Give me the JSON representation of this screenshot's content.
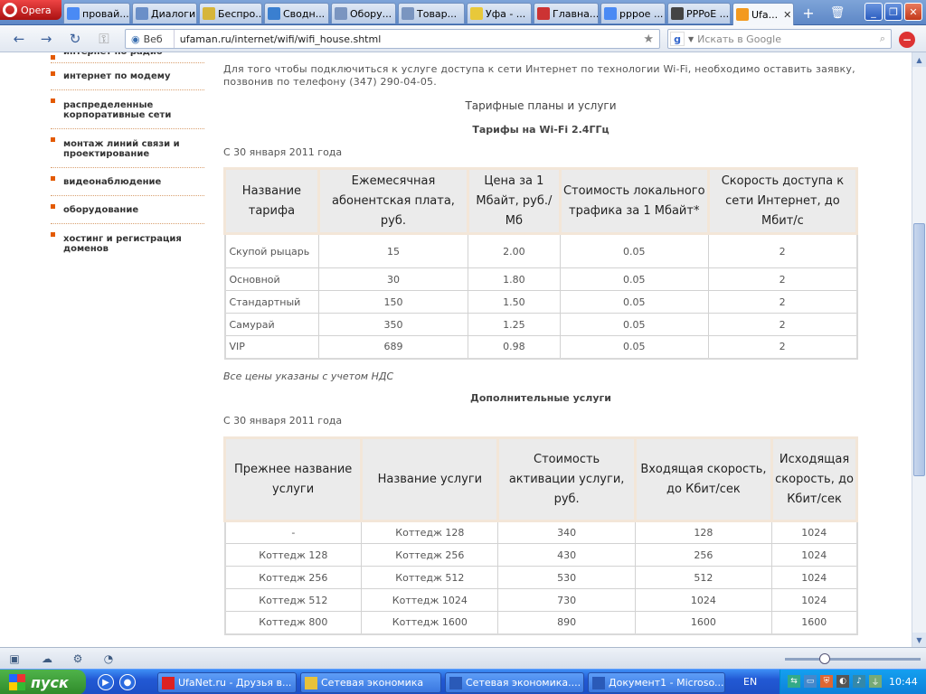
{
  "browser": {
    "menu_label": "Opera",
    "tabs": [
      {
        "label": "провай...",
        "icon": "google-icon"
      },
      {
        "label": "Диалоги",
        "icon": "chat-icon"
      },
      {
        "label": "Беспро...",
        "icon": "folder-icon"
      },
      {
        "label": "Сводн...",
        "icon": "table-icon"
      },
      {
        "label": "Обору...",
        "icon": "page-icon"
      },
      {
        "label": "Товар...",
        "icon": "page-icon"
      },
      {
        "label": "Уфа - ...",
        "icon": "yandex-icon"
      },
      {
        "label": "Главна...",
        "icon": "flag-icon"
      },
      {
        "label": "pppoe ...",
        "icon": "google-icon"
      },
      {
        "label": "PPPoE ...",
        "icon": "wikipedia-icon"
      },
      {
        "label": "Ufa...",
        "icon": "ufanet-icon"
      }
    ],
    "tab_close_glyph": "✕",
    "address": {
      "label": "Веб",
      "url": "ufaman.ru/internet/wifi/wifi_house.shtml"
    },
    "search_placeholder": "Искать в Google"
  },
  "sidebar": {
    "items": [
      "интернет по радио",
      "интернет по модему",
      "распределенные корпоративные сети",
      "монтаж линий связи и проектирование",
      "видеонаблюдение",
      "оборудование",
      "хостинг и регистрация доменов"
    ]
  },
  "content": {
    "intro": "Для того чтобы подключиться к услуге доступа к сети Интернет по технологии Wi-Fi, необходимо оставить заявку, позвонив по телефону (347) 290-04-05.",
    "section_title": "Тарифные планы и услуги",
    "tariffs_title": "Тарифы на Wi-Fi 2.4ГГц",
    "date1": "С 30 января 2011 года",
    "tariffs": {
      "headers": [
        "Название тарифа",
        "Ежемесячная абонентская плата, руб.",
        "Цена за 1 Мбайт, руб./Мб",
        "Стоимость локального трафика за 1 Мбайт*",
        "Скорость доступа к сети Интернет, до Мбит/с"
      ],
      "rows": [
        [
          "Скупой рыцарь",
          "15",
          "2.00",
          "0.05",
          "2"
        ],
        [
          "Основной",
          "30",
          "1.80",
          "0.05",
          "2"
        ],
        [
          "Стандартный",
          "150",
          "1.50",
          "0.05",
          "2"
        ],
        [
          "Самурай",
          "350",
          "1.25",
          "0.05",
          "2"
        ],
        [
          "VIP",
          "689",
          "0.98",
          "0.05",
          "2"
        ]
      ]
    },
    "vat_note": "Все цены указаны с учетом НДС",
    "extra_title": "Дополнительные услуги",
    "date2": "С 30 января 2011 года",
    "extras": {
      "headers": [
        "Прежнее название услуги",
        "Название услуги",
        "Стоимость активации услуги, руб.",
        "Входящая скорость, до Кбит/сек",
        "Исходящая скорость, до Кбит/сек"
      ],
      "rows": [
        [
          "-",
          "Коттедж 128",
          "340",
          "128",
          "1024"
        ],
        [
          "Коттедж 128",
          "Коттедж 256",
          "430",
          "256",
          "1024"
        ],
        [
          "Коттедж 256",
          "Коттедж 512",
          "530",
          "512",
          "1024"
        ],
        [
          "Коттедж 512",
          "Коттедж 1024",
          "730",
          "1024",
          "1024"
        ],
        [
          "Коттедж 800",
          "Коттедж 1600",
          "890",
          "1600",
          "1600"
        ]
      ]
    }
  },
  "taskbar": {
    "start_label": "пуск",
    "tasks": [
      {
        "label": "UfaNet.ru - Друзья в...",
        "icon": "opera-icon"
      },
      {
        "label": "Сетевая экономика",
        "icon": "folder-icon"
      },
      {
        "label": "Сетевая экономика....",
        "icon": "word-icon"
      },
      {
        "label": "Документ1 - Microso...",
        "icon": "word-icon"
      }
    ],
    "language": "EN",
    "clock": "10:44"
  }
}
